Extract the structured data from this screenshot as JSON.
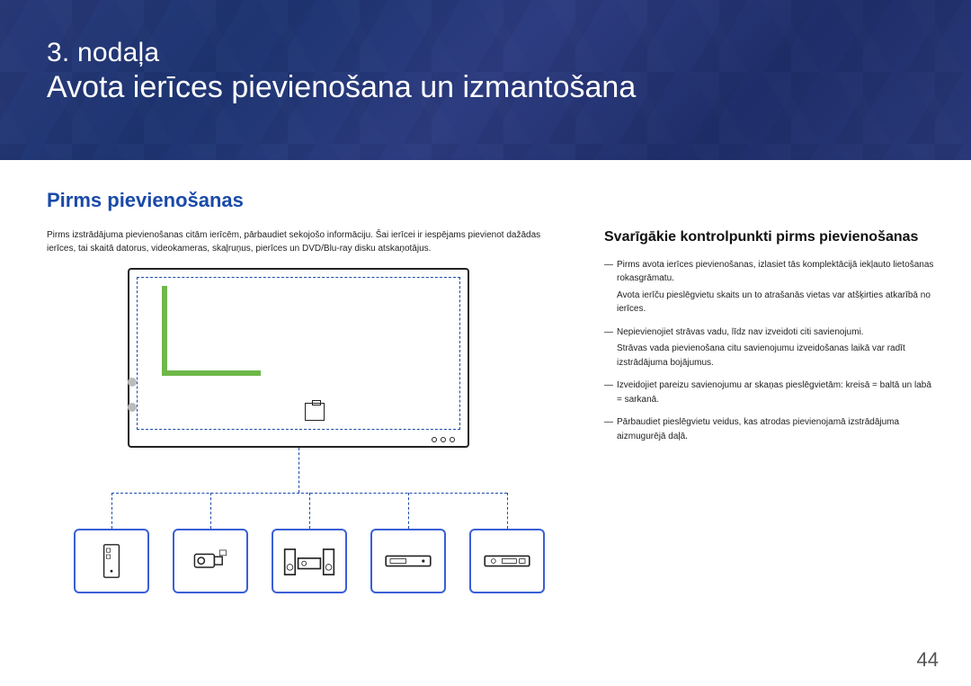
{
  "banner": {
    "chapter_no": "3. nodaļa",
    "chapter_title": "Avota ierīces pievienošana un izmantošana"
  },
  "section_title": "Pirms pievienošanas",
  "intro": "Pirms izstrādājuma pievienošanas citām ierīcēm, pārbaudiet sekojošo informāciju. Šai ierīcei ir iespējams pievienot dažādas ierīces, tai skaitā datorus, videokameras, skaļruņus, pierīces un DVD/Blu-ray disku atskaņotājus.",
  "sub_heading": "Svarīgākie kontrolpunkti pirms pievienošanas",
  "bullets": {
    "b1": "Pirms avota ierīces pievienošanas, izlasiet tās komplektācijā iekļauto lietošanas rokasgrāmatu.",
    "b1s": "Avota ierīču pieslēgvietu skaits un to atrašanās vietas var atšķirties atkarībā no ierīces.",
    "b2": "Nepievienojiet strāvas vadu, līdz nav izveidoti citi savienojumi.",
    "b2s": "Strāvas vada pievienošana citu savienojumu izveidošanas laikā var radīt izstrādājuma bojājumus.",
    "b3": "Izveidojiet pareizu savienojumu ar skaņas pieslēgvietām: kreisā = baltā un labā = sarkanā.",
    "b4": "Pārbaudiet pieslēgvietu veidus, kas atrodas pievienojamā izstrādājuma aizmugurējā daļā."
  },
  "page_number": "44"
}
